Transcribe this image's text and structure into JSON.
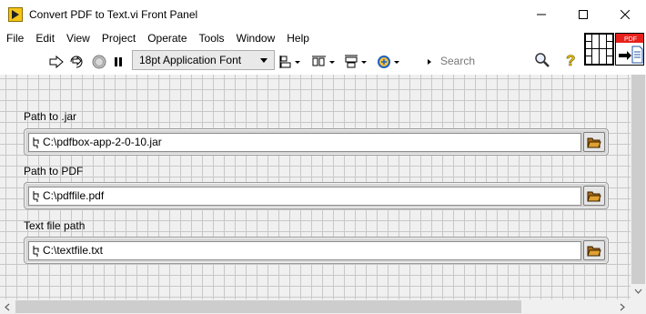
{
  "window": {
    "title": "Convert PDF to Text.vi Front Panel"
  },
  "menu": {
    "items": [
      "File",
      "Edit",
      "View",
      "Project",
      "Operate",
      "Tools",
      "Window",
      "Help"
    ]
  },
  "toolbar": {
    "font_select": "18pt Application Font",
    "search_placeholder": "Search",
    "icons": [
      "run-arrow-icon",
      "run-continuously-icon",
      "abort-icon",
      "pause-icon",
      "align-objects-icon",
      "distribute-objects-icon",
      "resize-objects-icon",
      "reorder-icon",
      "search-icon",
      "help-icon"
    ]
  },
  "vi_icon": {
    "badge": "PDF"
  },
  "controls": [
    {
      "label": "Path to .jar",
      "value": "C:\\pdfbox-app-2-0-10.jar"
    },
    {
      "label": "Path to PDF",
      "value": "C:\\pdffile.pdf"
    },
    {
      "label": "Text file path",
      "value": "C:\\textfile.txt"
    }
  ],
  "colors": {
    "panel_bg": "#f0f0f0",
    "grid": "#c8c8c8",
    "badge_red": "#e8201b",
    "abort_red": "#d22222"
  }
}
